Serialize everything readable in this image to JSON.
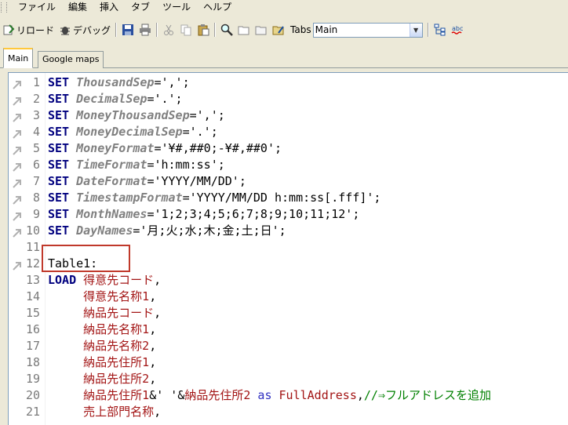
{
  "menu": [
    "ファイル",
    "編集",
    "挿入",
    "タブ",
    "ツール",
    "ヘルプ"
  ],
  "toolbar": {
    "reload_label": "リロード",
    "debug_label": "デバッグ",
    "tabs_label": "Tabs",
    "tabs_value": "Main"
  },
  "tabs": [
    {
      "label": "Main",
      "active": true
    },
    {
      "label": "Google maps",
      "active": false
    }
  ],
  "editor": {
    "lines": [
      {
        "n": "1",
        "bookmark": true,
        "parts": [
          {
            "t": "SET ",
            "c": "kw"
          },
          {
            "t": "ThousandSep",
            "c": "var"
          },
          {
            "t": "=',';",
            "c": "str"
          }
        ]
      },
      {
        "n": "2",
        "bookmark": true,
        "parts": [
          {
            "t": "SET ",
            "c": "kw"
          },
          {
            "t": "DecimalSep",
            "c": "var"
          },
          {
            "t": "='.';",
            "c": "str"
          }
        ]
      },
      {
        "n": "3",
        "bookmark": true,
        "parts": [
          {
            "t": "SET ",
            "c": "kw"
          },
          {
            "t": "MoneyThousandSep",
            "c": "var"
          },
          {
            "t": "=',';",
            "c": "str"
          }
        ]
      },
      {
        "n": "4",
        "bookmark": true,
        "parts": [
          {
            "t": "SET ",
            "c": "kw"
          },
          {
            "t": "MoneyDecimalSep",
            "c": "var"
          },
          {
            "t": "='.';",
            "c": "str"
          }
        ]
      },
      {
        "n": "5",
        "bookmark": true,
        "parts": [
          {
            "t": "SET ",
            "c": "kw"
          },
          {
            "t": "MoneyFormat",
            "c": "var"
          },
          {
            "t": "='¥#,##0;-¥#,##0';",
            "c": "str"
          }
        ]
      },
      {
        "n": "6",
        "bookmark": true,
        "parts": [
          {
            "t": "SET ",
            "c": "kw"
          },
          {
            "t": "TimeFormat",
            "c": "var"
          },
          {
            "t": "='h:mm:ss';",
            "c": "str"
          }
        ]
      },
      {
        "n": "7",
        "bookmark": true,
        "parts": [
          {
            "t": "SET ",
            "c": "kw"
          },
          {
            "t": "DateFormat",
            "c": "var"
          },
          {
            "t": "='YYYY/MM/DD';",
            "c": "str"
          }
        ]
      },
      {
        "n": "8",
        "bookmark": true,
        "parts": [
          {
            "t": "SET ",
            "c": "kw"
          },
          {
            "t": "TimestampFormat",
            "c": "var"
          },
          {
            "t": "='YYYY/MM/DD h:mm:ss[.fff]';",
            "c": "str"
          }
        ]
      },
      {
        "n": "9",
        "bookmark": true,
        "parts": [
          {
            "t": "SET ",
            "c": "kw"
          },
          {
            "t": "MonthNames",
            "c": "var"
          },
          {
            "t": "='1;2;3;4;5;6;7;8;9;10;11;12';",
            "c": "str"
          }
        ]
      },
      {
        "n": "10",
        "bookmark": true,
        "parts": [
          {
            "t": "SET ",
            "c": "kw"
          },
          {
            "t": "DayNames",
            "c": "var"
          },
          {
            "t": "='月;火;水;木;金;土;日';",
            "c": "str"
          }
        ]
      },
      {
        "n": "11",
        "bookmark": false,
        "parts": []
      },
      {
        "n": "12",
        "bookmark": true,
        "parts": [
          {
            "t": "Table1:",
            "c": "str"
          }
        ]
      },
      {
        "n": "13",
        "bookmark": false,
        "parts": [
          {
            "t": "LOAD ",
            "c": "kw"
          },
          {
            "t": "得意先コード",
            "c": "fld"
          },
          {
            "t": ",",
            "c": "str"
          }
        ]
      },
      {
        "n": "14",
        "bookmark": false,
        "parts": [
          {
            "t": "     ",
            "c": "str"
          },
          {
            "t": "得意先名称1",
            "c": "fld"
          },
          {
            "t": ",",
            "c": "str"
          }
        ]
      },
      {
        "n": "15",
        "bookmark": false,
        "parts": [
          {
            "t": "     ",
            "c": "str"
          },
          {
            "t": "納品先コード",
            "c": "fld"
          },
          {
            "t": ",",
            "c": "str"
          }
        ]
      },
      {
        "n": "16",
        "bookmark": false,
        "parts": [
          {
            "t": "     ",
            "c": "str"
          },
          {
            "t": "納品先名称1",
            "c": "fld"
          },
          {
            "t": ",",
            "c": "str"
          }
        ]
      },
      {
        "n": "17",
        "bookmark": false,
        "parts": [
          {
            "t": "     ",
            "c": "str"
          },
          {
            "t": "納品先名称2",
            "c": "fld"
          },
          {
            "t": ",",
            "c": "str"
          }
        ]
      },
      {
        "n": "18",
        "bookmark": false,
        "parts": [
          {
            "t": "     ",
            "c": "str"
          },
          {
            "t": "納品先住所1",
            "c": "fld"
          },
          {
            "t": ",",
            "c": "str"
          }
        ]
      },
      {
        "n": "19",
        "bookmark": false,
        "parts": [
          {
            "t": "     ",
            "c": "str"
          },
          {
            "t": "納品先住所2",
            "c": "fld"
          },
          {
            "t": ",",
            "c": "str"
          }
        ]
      },
      {
        "n": "20",
        "bookmark": false,
        "parts": [
          {
            "t": "     ",
            "c": "str"
          },
          {
            "t": "納品先住所1",
            "c": "fld"
          },
          {
            "t": "&' '&",
            "c": "str"
          },
          {
            "t": "納品先住所2",
            "c": "fld"
          },
          {
            "t": " as ",
            "c": "kw2"
          },
          {
            "t": "FullAddress",
            "c": "fld"
          },
          {
            "t": ",",
            "c": "str"
          },
          {
            "t": "//⇒フルアドレスを追加",
            "c": "cmt"
          }
        ]
      },
      {
        "n": "21",
        "bookmark": false,
        "parts": [
          {
            "t": "     ",
            "c": "str"
          },
          {
            "t": "売上部門名称",
            "c": "fld"
          },
          {
            "t": ",",
            "c": "str"
          }
        ]
      }
    ]
  }
}
